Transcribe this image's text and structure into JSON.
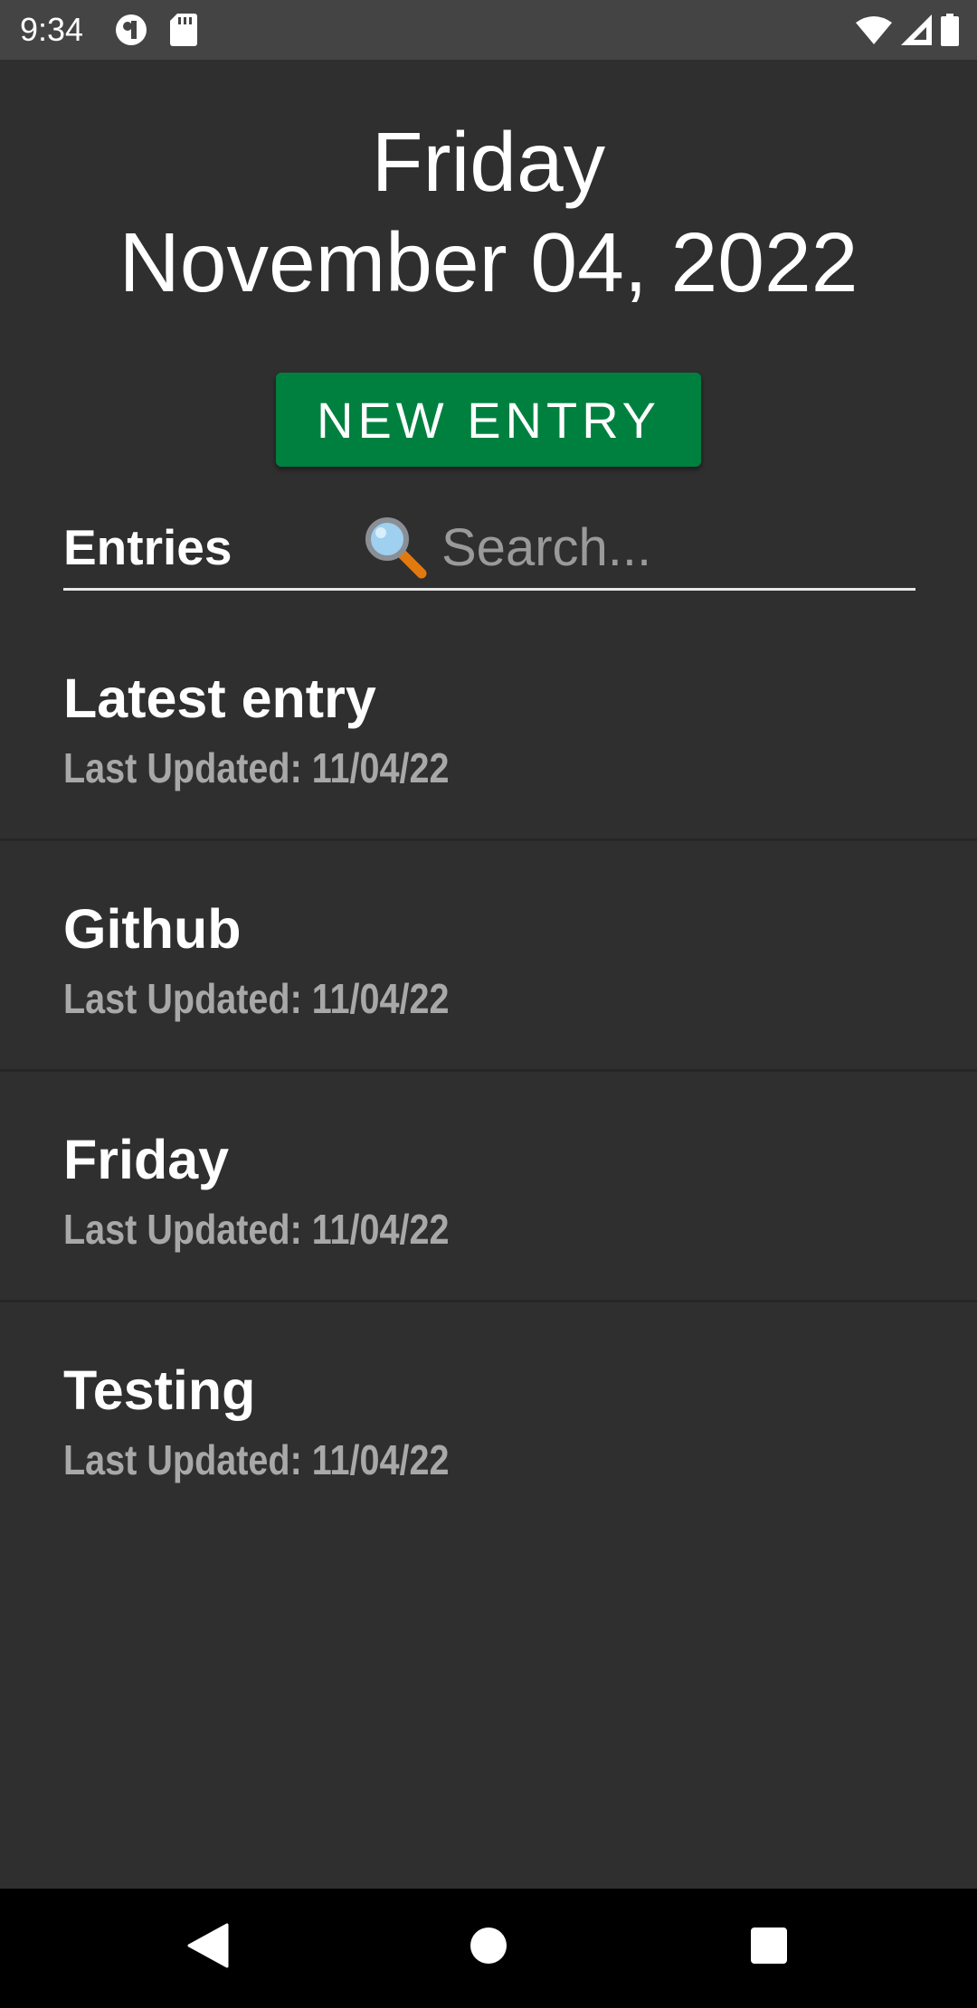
{
  "status_bar": {
    "time": "9:34",
    "icons_left": [
      "vpn-key-icon",
      "sd-card-icon"
    ],
    "icons_right": [
      "wifi-icon",
      "signal-icon",
      "battery-icon"
    ]
  },
  "header": {
    "day": "Friday",
    "date": "November 04, 2022"
  },
  "actions": {
    "new_entry_label": "NEW ENTRY"
  },
  "entries_section": {
    "label": "Entries",
    "search_placeholder": "Search...",
    "search_value": ""
  },
  "entries": [
    {
      "title": "Latest entry",
      "subtitle": "Last Updated: 11/04/22"
    },
    {
      "title": "Github",
      "subtitle": "Last Updated: 11/04/22"
    },
    {
      "title": "Friday",
      "subtitle": "Last Updated: 11/04/22"
    },
    {
      "title": "Testing",
      "subtitle": "Last Updated: 11/04/22"
    }
  ],
  "nav_bar": {
    "buttons": [
      "back-icon",
      "home-icon",
      "recents-icon"
    ]
  },
  "colors": {
    "background": "#2f2f2f",
    "status_bar": "#444444",
    "accent_button": "#00803f",
    "subtitle_text": "#a8a8a8",
    "nav_bar": "#000000"
  }
}
